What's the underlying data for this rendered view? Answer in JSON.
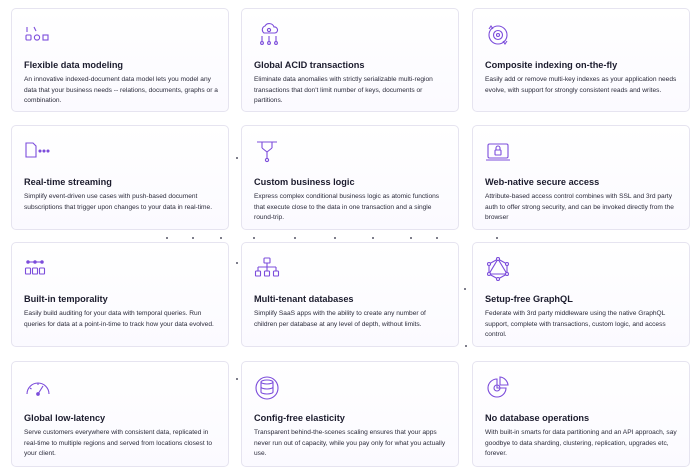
{
  "features": [
    {
      "icon": "data-model-icon",
      "title": "Flexible data modeling",
      "desc": "An innovative indexed-document data model lets you model any data that your business needs -- relations, documents, graphs or a combination."
    },
    {
      "icon": "transactions-icon",
      "title": "Global ACID transactions",
      "desc": "Eliminate data anomalies with strictly serializable multi-region transactions that don't limit number of keys, documents or partitions."
    },
    {
      "icon": "indexing-icon",
      "title": "Composite indexing on-the-fly",
      "desc": "Easily add or remove multi-key indexes as your application needs evolve, with support for strongly consistent reads and writes."
    },
    {
      "icon": "streaming-icon",
      "title": "Real-time streaming",
      "desc": "Simplify event-driven use cases with push-based document subscriptions that trigger upon changes to your data in real-time."
    },
    {
      "icon": "business-logic-icon",
      "title": "Custom business logic",
      "desc": "Express complex conditional business logic as atomic functions that execute close to the data in one transaction and a single round-trip."
    },
    {
      "icon": "lock-icon",
      "title": "Web-native secure access",
      "desc": "Attribute-based access control combines with SSL and 3rd party auth to offer strong security, and can be invoked directly from the browser"
    },
    {
      "icon": "temporality-icon",
      "title": "Built-in temporality",
      "desc": "Easily build auditing for your data with temporal queries. Run queries for data at a point-in-time to track how your data evolved."
    },
    {
      "icon": "multi-tenant-icon",
      "title": "Multi-tenant databases",
      "desc": "Simplify SaaS apps with the ability to create any number of children per database at any level of depth, without limits."
    },
    {
      "icon": "graphql-icon",
      "title": "Setup-free GraphQL",
      "desc": "Federate with 3rd party middleware using the native GraphQL support, complete with transactions, custom logic, and access control."
    },
    {
      "icon": "latency-gauge-icon",
      "title": "Global low-latency",
      "desc": "Serve customers everywhere with consistent data, replicated in real-time to multiple regions and served from locations closest to your client."
    },
    {
      "icon": "elasticity-icon",
      "title": "Config-free elasticity",
      "desc": "Transparent behind-the-scenes scaling ensures that your apps never run out of capacity, while you pay only for what you actually use."
    },
    {
      "icon": "no-ops-icon",
      "title": "No database operations",
      "desc": "With built-in smarts for data partitioning and an API approach, say goodbye to data sharding, clustering, replication, upgrades etc, forever."
    }
  ],
  "accent_color": "#7c4ddb"
}
